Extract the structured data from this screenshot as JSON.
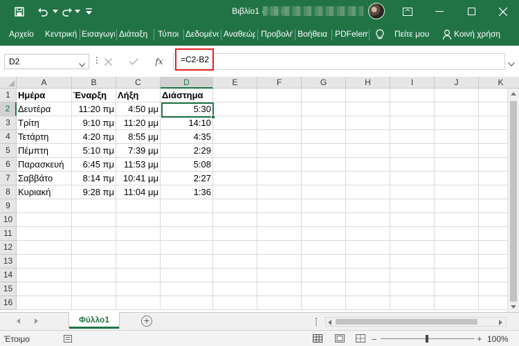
{
  "window": {
    "title": "Βιβλίο1  -  Excel",
    "quick_access": [
      "save-icon",
      "undo-icon",
      "redo-icon",
      "customize-icon"
    ],
    "controls": [
      "ribbon-display-icon",
      "minimize-icon",
      "maximize-icon",
      "close-icon"
    ]
  },
  "ribbon": {
    "tabs": [
      "Αρχείο",
      "Κεντρική",
      "Εισαγωγή",
      "Διάταξη",
      "Τύποι",
      "Δεδομένα",
      "Αναθεώρηση",
      "Προβολή",
      "Βοήθεια",
      "PDFelement"
    ],
    "tell_me": "Πείτε μου",
    "share": "Κοινή χρήση"
  },
  "formula_bar": {
    "name_box": "D2",
    "formula": "=C2-B2"
  },
  "grid": {
    "columns": [
      "A",
      "B",
      "C",
      "D",
      "E",
      "F",
      "G",
      "H",
      "I",
      "J",
      "K"
    ],
    "rows": [
      [
        "Ημέρα",
        "Έναρξη",
        "Λήξη",
        "Διάστημα"
      ],
      [
        "Δευτέρα",
        "11:20 πμ",
        "4:50 μμ",
        "5:30"
      ],
      [
        "Τρίτη",
        "9:10 πμ",
        "11:20 μμ",
        "14:10"
      ],
      [
        "Τετάρτη",
        "4:20 πμ",
        "8:55 μμ",
        "4:35"
      ],
      [
        "Πέμπτη",
        "5:10 πμ",
        "7:39 μμ",
        "2:29"
      ],
      [
        "Παρασκευή",
        "6:45 πμ",
        "11:53 μμ",
        "5:08"
      ],
      [
        "Σαββάτο",
        "8:14 πμ",
        "10:41 μμ",
        "2:27"
      ],
      [
        "Κυριακή",
        "9:28 πμ",
        "11:04 μμ",
        "1:36"
      ],
      [],
      [],
      [],
      [],
      [],
      [],
      [],
      []
    ],
    "row_numbers": [
      "1",
      "2",
      "3",
      "4",
      "5",
      "6",
      "7",
      "8",
      "9",
      "10",
      "11",
      "12",
      "13",
      "14",
      "15",
      "16"
    ],
    "selected_cell": "D2"
  },
  "sheets": {
    "tabs": [
      "Φύλλο1"
    ],
    "active": "Φύλλο1"
  },
  "status": {
    "text": "Έτοιμο",
    "zoom": "100%"
  },
  "colors": {
    "accent": "#217346",
    "highlight_border": "#e0201d"
  }
}
